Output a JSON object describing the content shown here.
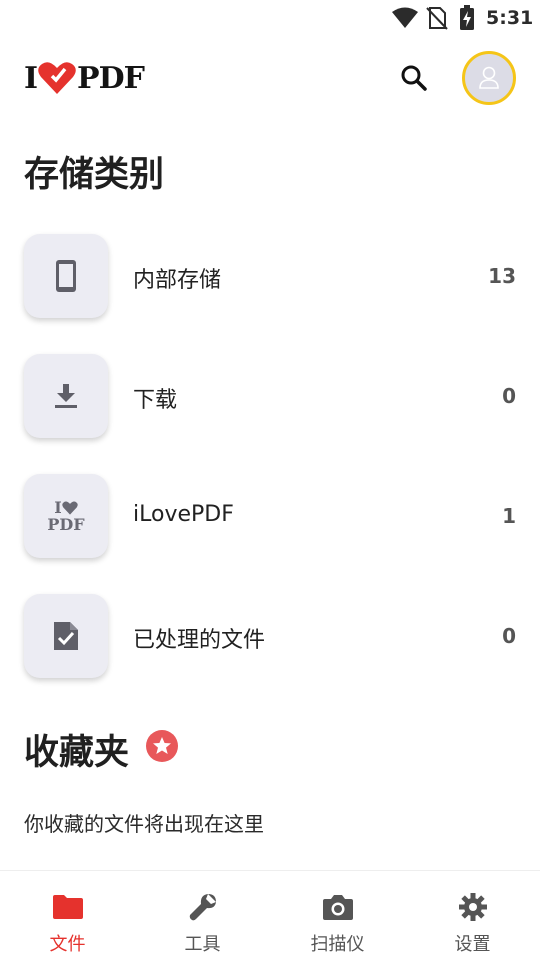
{
  "status_bar": {
    "time": "5:31"
  },
  "header": {
    "logo_left": "I",
    "logo_right": "PDF"
  },
  "storage": {
    "title": "存储类别",
    "items": [
      {
        "label": "内部存储",
        "count": "13",
        "icon": "phone-icon"
      },
      {
        "label": "下载",
        "count": "0",
        "icon": "download-icon"
      },
      {
        "label": "iLovePDF",
        "count": "1",
        "icon": "ilovepdf-logo-icon"
      },
      {
        "label": "已处理的文件",
        "count": "0",
        "icon": "processed-file-icon"
      }
    ],
    "mini_logo_top": "I",
    "mini_logo_bottom": "PDF"
  },
  "favorites": {
    "title": "收藏夹",
    "empty_text": "你收藏的文件将出现在这里"
  },
  "bottom_nav": {
    "items": [
      {
        "label": "文件",
        "icon": "folder-icon",
        "active": true
      },
      {
        "label": "工具",
        "icon": "wrench-icon",
        "active": false
      },
      {
        "label": "扫描仪",
        "icon": "camera-icon",
        "active": false
      },
      {
        "label": "设置",
        "icon": "gear-icon",
        "active": false
      }
    ]
  },
  "colors": {
    "brand_red": "#e5322d",
    "avatar_ring": "#f5c518",
    "tile_bg": "#ececf3",
    "star_badge": "#e8585a"
  }
}
